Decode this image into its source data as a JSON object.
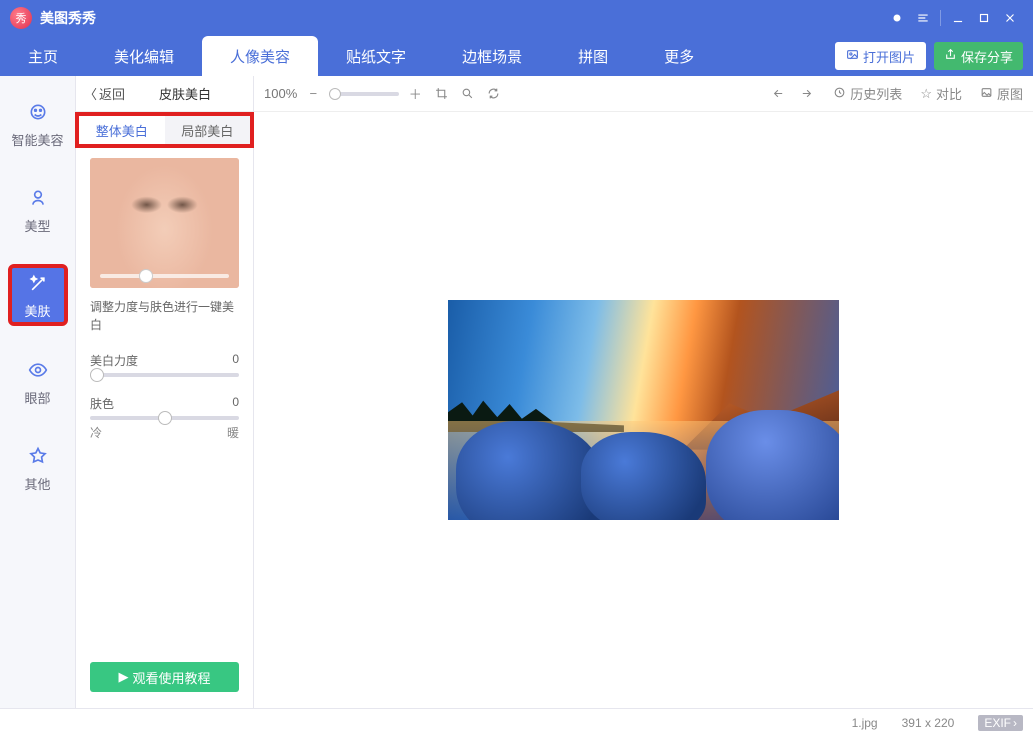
{
  "app": {
    "name": "美图秀秀"
  },
  "window_controls": {
    "chat": "●",
    "menu": "≡",
    "min": "—",
    "max": "☐",
    "close": "✕"
  },
  "topnav": {
    "tabs": [
      "主页",
      "美化编辑",
      "人像美容",
      "贴纸文字",
      "边框场景",
      "拼图",
      "更多"
    ],
    "active_index": 2,
    "open_image": "打开图片",
    "save_share": "保存分享"
  },
  "left_sidebar": {
    "items": [
      {
        "label": "智能美容",
        "icon": "face-smart-icon"
      },
      {
        "label": "美型",
        "icon": "shape-icon"
      },
      {
        "label": "美肤",
        "icon": "wand-icon"
      },
      {
        "label": "眼部",
        "icon": "eye-icon"
      },
      {
        "label": "其他",
        "icon": "star-icon"
      }
    ],
    "highlight_index": 2
  },
  "ctrl_panel": {
    "back": "返回",
    "title": "皮肤美白",
    "subtabs": {
      "items": [
        "整体美白",
        "局部美白"
      ],
      "active_index": 0
    },
    "desc": "调整力度与肤色进行一键美白",
    "slider1": {
      "label": "美白力度",
      "value": "0",
      "knob_pct": 0
    },
    "slider2": {
      "label": "肤色",
      "value": "0",
      "knob_pct": 50,
      "left_label": "冷",
      "right_label": "暖"
    },
    "tutorial": "观看使用教程"
  },
  "canvas_toolbar": {
    "zoom": "100%",
    "history": "历史列表",
    "compare": "对比",
    "original": "原图"
  },
  "status": {
    "filename": "1.jpg",
    "dimensions": "391 x 220",
    "exif": "EXIF"
  }
}
